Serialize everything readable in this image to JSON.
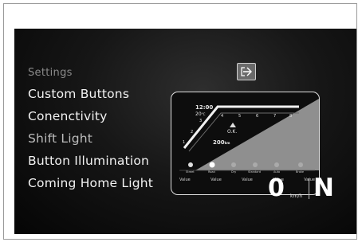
{
  "menu": {
    "title": "Settings",
    "items": [
      "Custom Buttons",
      "Conenctivity",
      "Shift Light",
      "Button Illumination",
      "Coming Home Light"
    ],
    "selected_index": 2
  },
  "preview": {
    "time": "12:00",
    "temp": "20",
    "temp_unit": "°C",
    "rpm_ticks": [
      "1",
      "2",
      "3",
      "4",
      "5",
      "6",
      "7",
      "8"
    ],
    "status": "O.K.",
    "range": "200",
    "range_unit": "km",
    "modes": [
      "Street",
      "Road",
      "Dry",
      "Standard",
      "Auto",
      "Brake"
    ],
    "values": [
      "Value",
      "Value",
      "Value",
      "Value",
      "Value"
    ]
  },
  "speed": {
    "value": "0",
    "unit": "km/h"
  },
  "gear": "N",
  "icons": {
    "exit": "exit-arrow-icon"
  },
  "colors": {
    "background": "#0a0a0a",
    "text": "#f2f2f2",
    "accent": "#bdbdbd"
  }
}
